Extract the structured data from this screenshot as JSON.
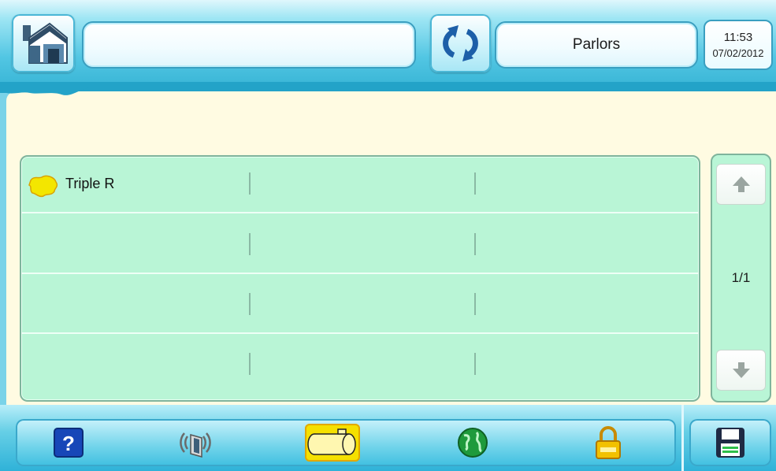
{
  "header": {
    "title_value": "",
    "section": "Parlors",
    "time": "11:53",
    "date": "07/02/2012"
  },
  "list": {
    "rows": [
      {
        "name": "Triple R",
        "icon": "farm-icon",
        "col2": "",
        "col3": ""
      },
      {
        "name": "",
        "col2": "",
        "col3": ""
      },
      {
        "name": "",
        "col2": "",
        "col3": ""
      },
      {
        "name": "",
        "col2": "",
        "col3": ""
      }
    ],
    "page": "1/1"
  },
  "toolbar": {
    "items": [
      "help-icon",
      "wireless-device-icon",
      "milk-tank-icon",
      "globe-icon",
      "lock-icon"
    ],
    "active": "milk-tank-icon",
    "save": "save-icon"
  },
  "colors": {
    "accent": "#3db8d8",
    "list_bg": "#b9f5d6",
    "band_bg": "#fffbe2",
    "active_btn": "#f5e000"
  }
}
